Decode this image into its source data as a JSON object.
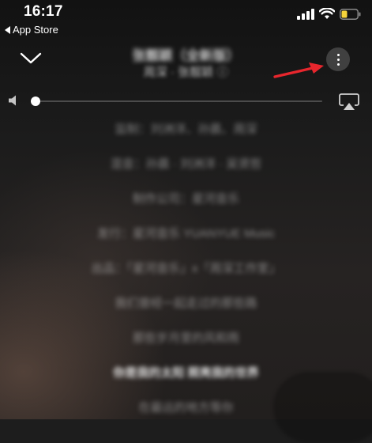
{
  "status_bar": {
    "time": "16:17",
    "back_app_label": "App Store",
    "icons": [
      "signal-bars-icon",
      "wifi-icon",
      "battery-icon"
    ],
    "battery_color": "#f5d33a"
  },
  "header": {
    "collapse_icon": "chevron-down-icon",
    "title": "张靓颖（全新版）",
    "artist": "周深 · 张靓颖 ⓘ",
    "more_icon": "more-vertical-icon",
    "annotation_color": "#e8262d"
  },
  "volume": {
    "level": 0.0,
    "speaker_icon": "speaker-icon",
    "airplay_icon": "airplay-icon"
  },
  "lyrics": [
    "监制：刘洲洋、孙晨、周深",
    "混音：孙晨 · 刘洲洋 · 吴贤哲",
    "制作公司：星河音乐",
    "发行：星河音乐 YUANYUE Music",
    "出品：「星河音乐」x「周深工作室」",
    "我们曾经一起走过的那些路",
    "那些岁月里的风和雨",
    "你是我的太阳 照亮我的世界",
    "在最远的地方等你"
  ]
}
